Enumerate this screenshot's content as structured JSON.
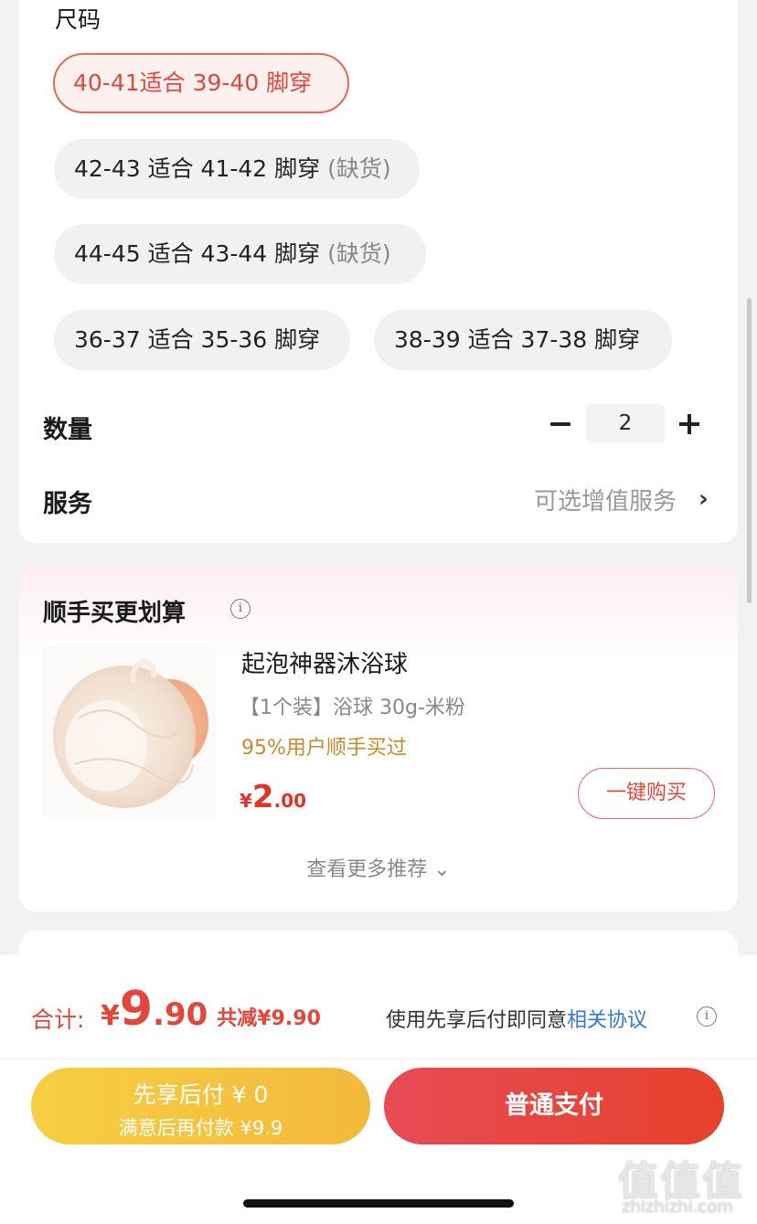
{
  "size_section": {
    "title": "尺码",
    "options": [
      {
        "label": "40-41适合 39-40 脚穿",
        "status": "",
        "selected": true
      },
      {
        "label": "42-43 适合 41-42 脚穿",
        "status": "(缺货)",
        "selected": false
      },
      {
        "label": "44-45 适合 43-44 脚穿",
        "status": "(缺货)",
        "selected": false
      },
      {
        "label": "36-37 适合 35-36 脚穿",
        "status": "",
        "selected": false
      },
      {
        "label": "38-39 适合 37-38 脚穿",
        "status": "",
        "selected": false
      }
    ]
  },
  "quantity": {
    "label": "数量",
    "value": "2"
  },
  "service": {
    "label": "服务",
    "value": "可选增值服务",
    "chevron": "›"
  },
  "addon": {
    "title": "顺手买更划算",
    "info_icon": "i",
    "product": {
      "name": "起泡神器沐浴球",
      "spec": "【1个装】浴球 30g-米粉",
      "social_proof": "95%用户顺手买过",
      "price_symbol": "¥",
      "price_int": "2",
      "price_dec": ".00",
      "buy_label": "一键购买"
    },
    "more": "查看更多推荐 ⌄"
  },
  "footer": {
    "total_label": "合计:",
    "total_symbol": "¥",
    "total_int": "9",
    "total_dec": ".90",
    "saved": "共减¥9.90",
    "agree_text": "使用先享后付即同意",
    "agree_link": "相关协议",
    "info_icon": "i",
    "pay_later_line1": "先享后付 ¥ 0",
    "pay_later_line2": "满意后再付款 ¥9.9",
    "pay_now_label": "普通支付"
  },
  "watermark": {
    "logo": "值值值",
    "url": "zhizhizhi.com"
  },
  "colors": {
    "accent": "#e3463a",
    "gold": "#f4c33f",
    "link": "#3477d6"
  }
}
